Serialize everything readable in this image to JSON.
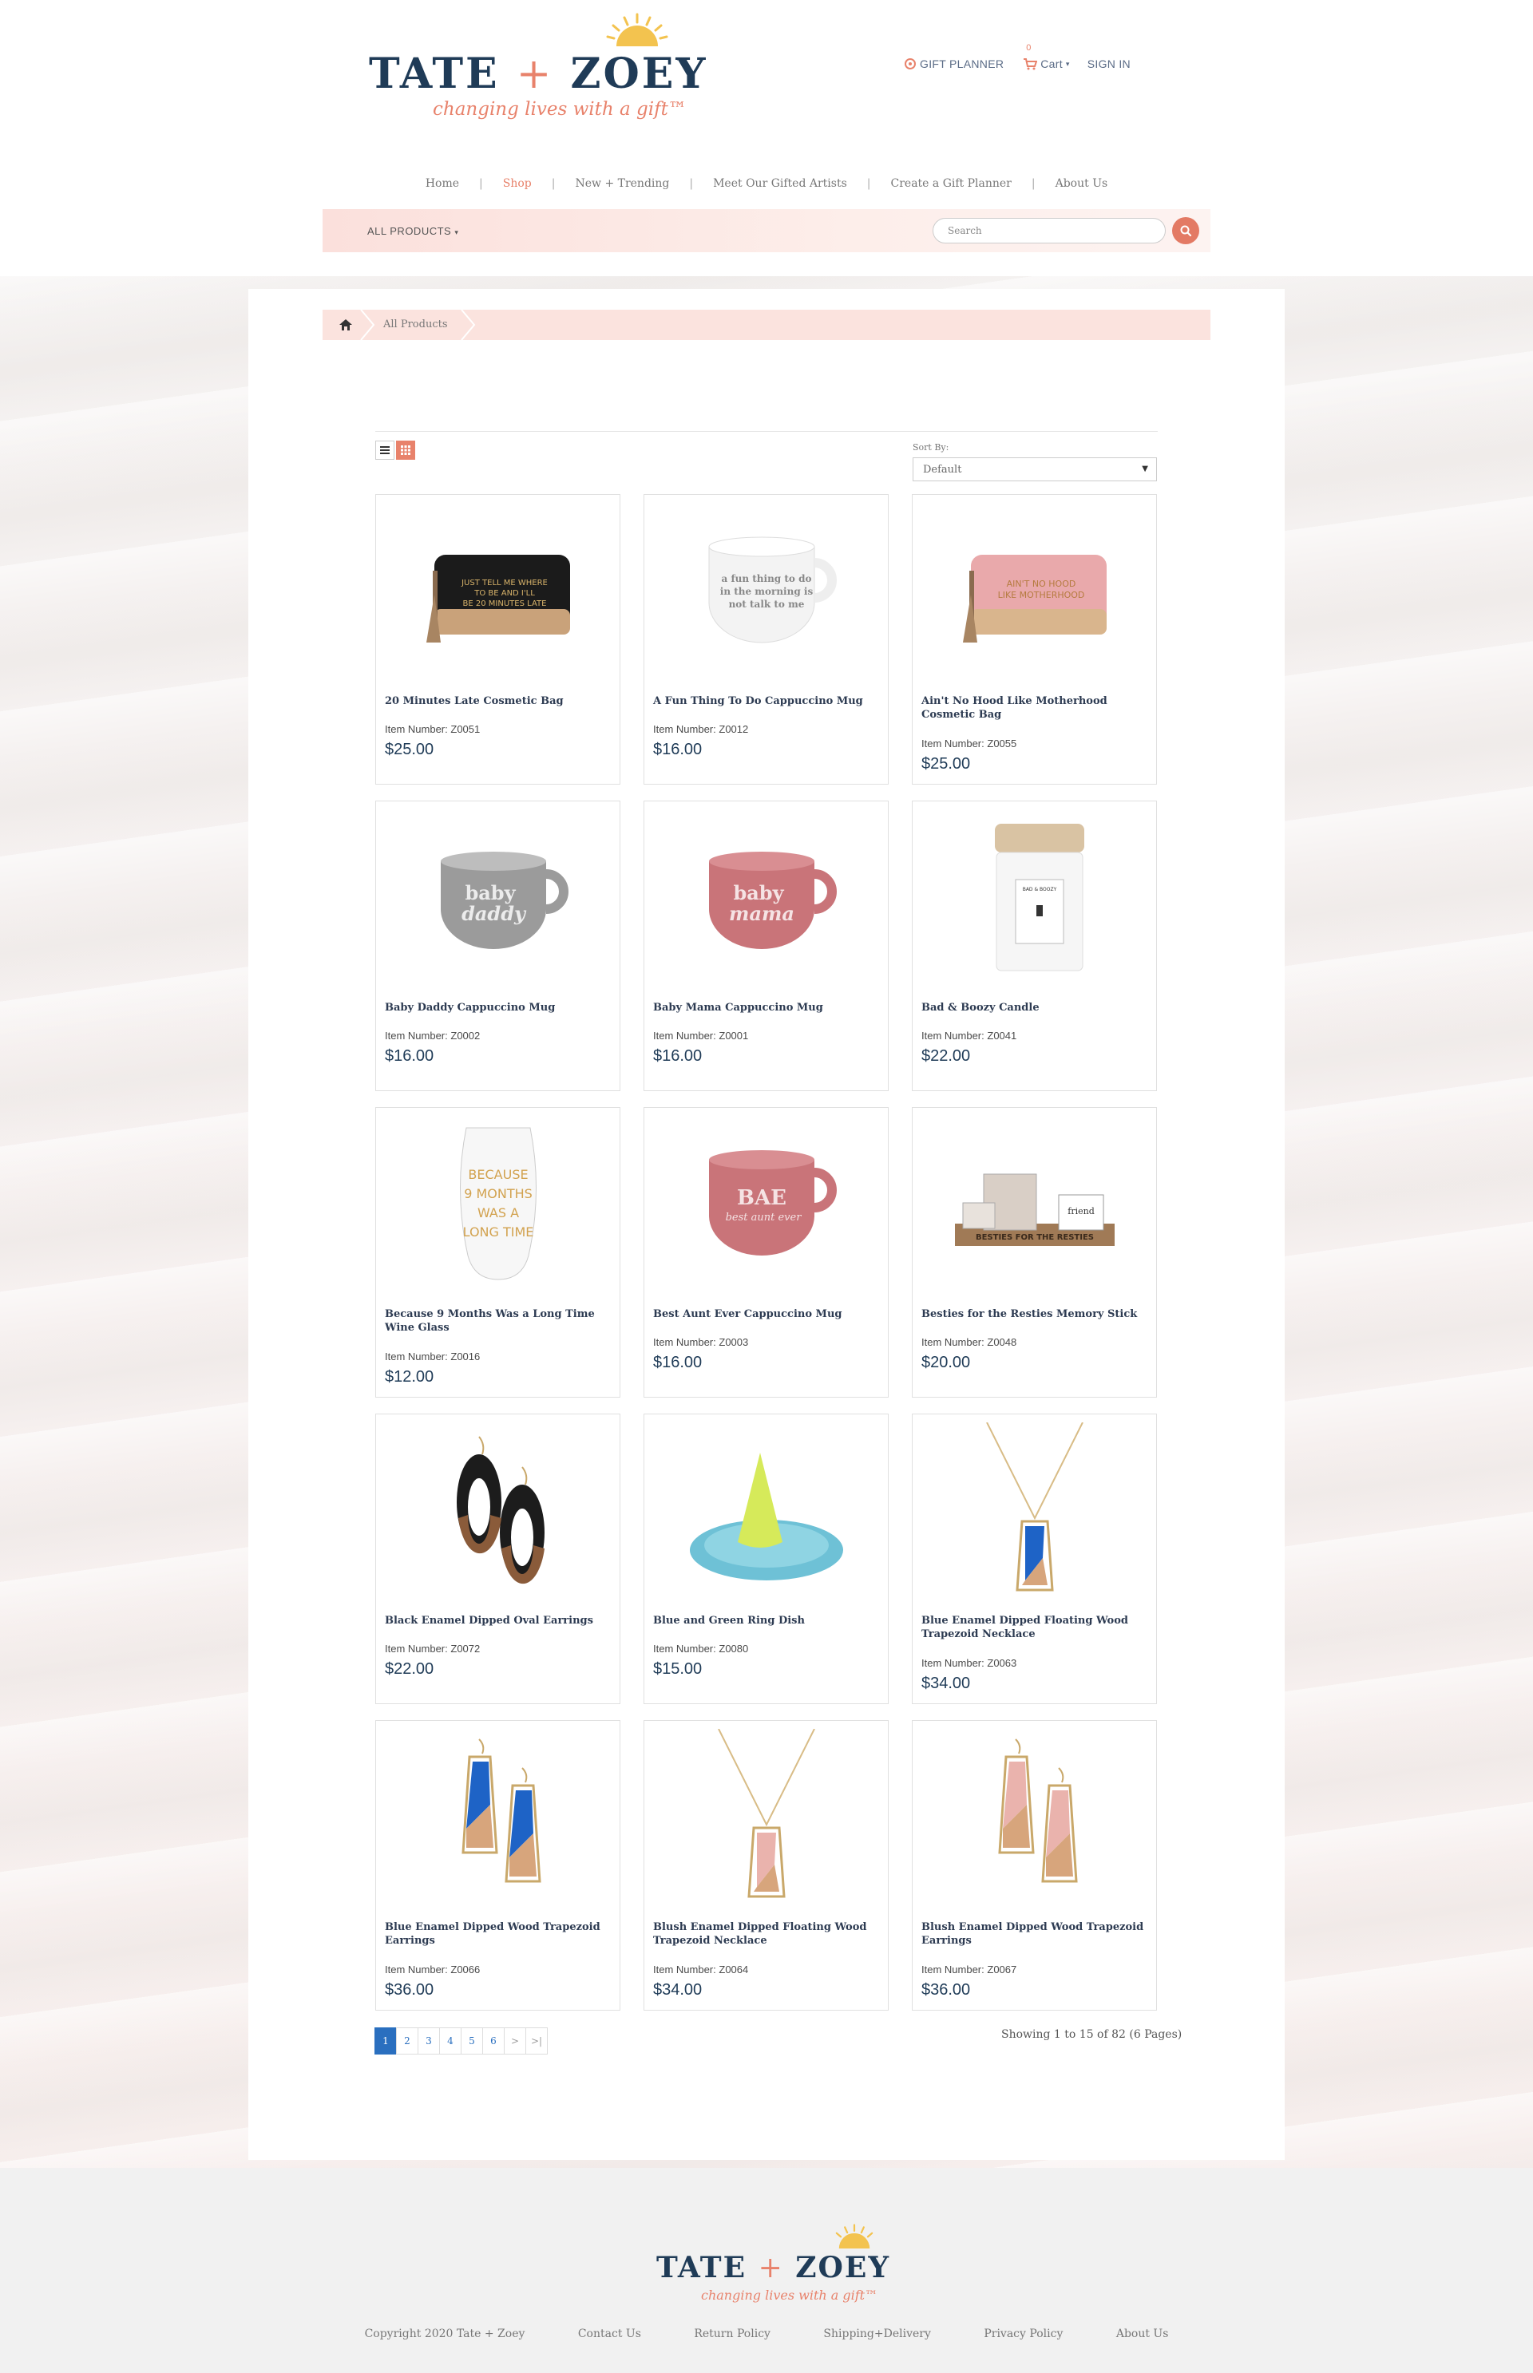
{
  "brand": {
    "name_left": "TATE",
    "plus": "+",
    "name_right": "ZOEY",
    "tm": "™",
    "tagline": "changing lives with a gift™"
  },
  "top_links": {
    "gift_planner": "GIFT PLANNER",
    "cart_label": "Cart",
    "cart_count": "0",
    "sign_in": "SIGN IN"
  },
  "nav": {
    "items": [
      "Home",
      "Shop",
      "New + Trending",
      "Meet Our Gifted Artists",
      "Create a Gift Planner",
      "About Us"
    ],
    "separator": "|",
    "active": "Shop"
  },
  "filter": {
    "category": "ALL PRODUCTS",
    "search_placeholder": "Search"
  },
  "breadcrumb": {
    "current": "All Products"
  },
  "sort": {
    "label": "Sort By:",
    "value": "Default"
  },
  "item_prefix": "Item Number:",
  "products": [
    {
      "title": "20 Minutes Late Cosmetic Bag",
      "item": "Z0051",
      "price": "$25.00",
      "image": "cosmetic-bag-black",
      "img_text": "JUST TELL ME WHERE TO BE AND I'LL BE 20 MINUTES LATE"
    },
    {
      "title": "A Fun Thing To Do Cappuccino Mug",
      "item": "Z0012",
      "price": "$16.00",
      "image": "mug-white",
      "img_text": "a fun thing to do in the morning is not talk to me"
    },
    {
      "title": "Ain't No Hood Like Motherhood Cosmetic Bag",
      "item": "Z0055",
      "price": "$25.00",
      "image": "cosmetic-bag-pink",
      "img_text": "AIN'T NO HOOD LIKE MOTHERHOOD"
    },
    {
      "title": "Baby Daddy Cappuccino Mug",
      "item": "Z0002",
      "price": "$16.00",
      "image": "mug-gray",
      "img_text": "baby daddy"
    },
    {
      "title": "Baby Mama Cappuccino Mug",
      "item": "Z0001",
      "price": "$16.00",
      "image": "mug-pink",
      "img_text": "baby mama"
    },
    {
      "title": "Bad & Boozy Candle",
      "item": "Z0041",
      "price": "$22.00",
      "image": "candle",
      "img_text": "BAD & BOOZY"
    },
    {
      "title": "Because 9 Months Was a Long Time Wine Glass",
      "item": "Z0016",
      "price": "$12.00",
      "image": "wine-glass",
      "img_text": "BECAUSE 9 MONTHS WAS A LONG TIME"
    },
    {
      "title": "Best Aunt Ever Cappuccino Mug",
      "item": "Z0003",
      "price": "$16.00",
      "image": "mug-pink-bae",
      "img_text": "BAE best aunt ever"
    },
    {
      "title": "Besties for the Resties Memory Stick",
      "item": "Z0048",
      "price": "$20.00",
      "image": "memory-stick",
      "img_text": "BESTIES FOR THE RESTIES"
    },
    {
      "title": "Black Enamel Dipped Oval Earrings",
      "item": "Z0072",
      "price": "$22.00",
      "image": "earrings-oval-black",
      "img_text": ""
    },
    {
      "title": "Blue and Green Ring Dish",
      "item": "Z0080",
      "price": "$15.00",
      "image": "ring-dish",
      "img_text": ""
    },
    {
      "title": "Blue Enamel Dipped Floating Wood Trapezoid Necklace",
      "item": "Z0063",
      "price": "$34.00",
      "image": "necklace-blue",
      "img_text": ""
    },
    {
      "title": "Blue Enamel Dipped Wood Trapezoid Earrings",
      "item": "Z0066",
      "price": "$36.00",
      "image": "earrings-blue",
      "img_text": ""
    },
    {
      "title": "Blush Enamel Dipped Floating Wood Trapezoid Necklace",
      "item": "Z0064",
      "price": "$34.00",
      "image": "necklace-blush",
      "img_text": ""
    },
    {
      "title": "Blush Enamel Dipped Wood Trapezoid Earrings",
      "item": "Z0067",
      "price": "$36.00",
      "image": "earrings-blush",
      "img_text": ""
    }
  ],
  "pagination": {
    "pages": [
      "1",
      "2",
      "3",
      "4",
      "5",
      "6",
      ">",
      ">|"
    ],
    "current": "1",
    "showing": "Showing 1 to 15 of 82 (6 Pages)"
  },
  "footer": {
    "links": [
      "Copyright 2020 Tate + Zoey",
      "Contact Us",
      "Return Policy",
      "Shipping+Delivery",
      "Privacy Policy",
      "About Us"
    ]
  },
  "colors": {
    "brand_navy": "#1f3b57",
    "brand_coral": "#e8826b",
    "accent_blue": "#2a6fbf"
  }
}
